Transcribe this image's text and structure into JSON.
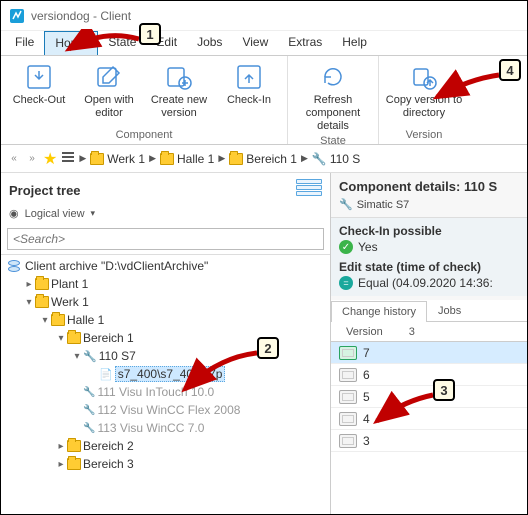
{
  "window": {
    "title": "versiondog - Client"
  },
  "menu": {
    "file": "File",
    "home": "Home",
    "state": "State",
    "edit": "Edit",
    "jobs": "Jobs",
    "view": "View",
    "extras": "Extras",
    "help": "Help"
  },
  "ribbon": {
    "component_group": "Component",
    "state_group": "State",
    "version_group": "Version",
    "check_out": "Check-Out",
    "open_editor": "Open with editor",
    "create_version": "Create new version",
    "check_in": "Check-In",
    "refresh_details": "Refresh component details",
    "copy_version": "Copy version to directory"
  },
  "breadcrumb": {
    "werk": "Werk 1",
    "halle": "Halle 1",
    "bereich": "Bereich 1",
    "device": "110 S"
  },
  "left": {
    "title": "Project tree",
    "view_mode": "Logical view",
    "search_placeholder": "<Search>",
    "archive_label": "Client archive \"D:\\vdClientArchive\"",
    "plant1": "Plant 1",
    "werk1": "Werk 1",
    "halle1": "Halle 1",
    "bereich1": "Bereich 1",
    "dev110": "110 S7",
    "dev110_file": "s7_400\\s7_400.s7p",
    "dev111": "111 Visu InTouch 10.0",
    "dev112": "112 Visu WinCC Flex 2008",
    "dev113": "113 Visu WinCC 7.0",
    "bereich2": "Bereich 2",
    "bereich3": "Bereich 3"
  },
  "right": {
    "title": "Component details: 110 S",
    "type": "Simatic S7",
    "checkin_label": "Check-In possible",
    "checkin_value": "Yes",
    "editstate_label": "Edit state (time of check)",
    "editstate_value": "Equal (04.09.2020 14:36:",
    "tab_change": "Change history",
    "tab_jobs": "Jobs",
    "subtab_version": "Version",
    "col_3": "3",
    "versions": [
      "7",
      "6",
      "5",
      "4",
      "3"
    ]
  },
  "callouts": {
    "c1": "1",
    "c2": "2",
    "c3": "3",
    "c4": "4"
  }
}
